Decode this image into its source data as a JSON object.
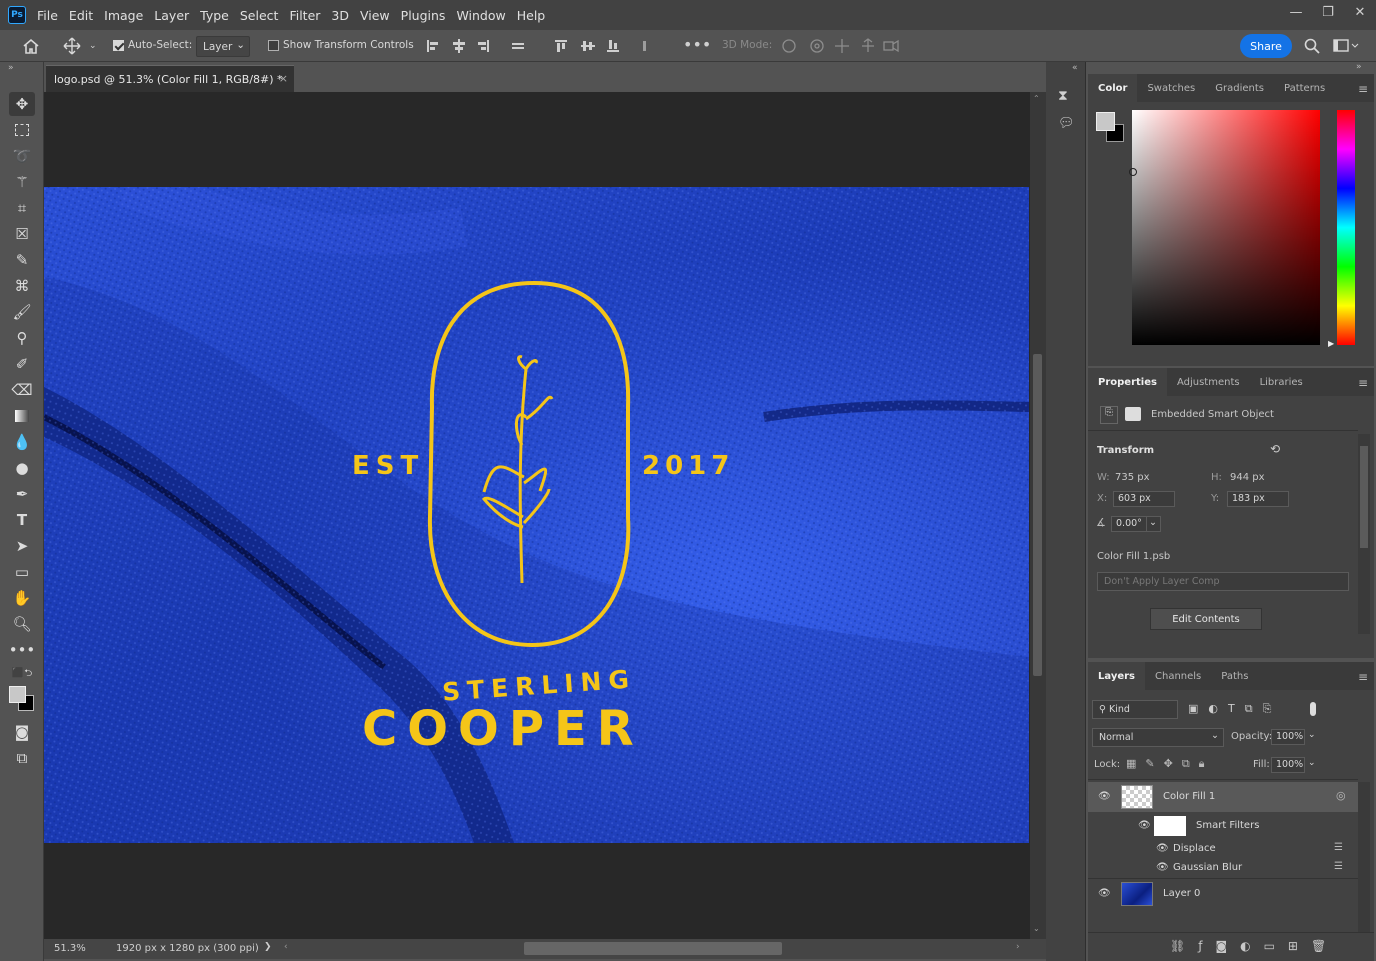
{
  "app": {
    "logo_text": "Ps"
  },
  "menu": [
    "File",
    "Edit",
    "Image",
    "Layer",
    "Type",
    "Select",
    "Filter",
    "3D",
    "View",
    "Plugins",
    "Window",
    "Help"
  ],
  "window_controls": {
    "minimize": "—",
    "maximize": "❐",
    "close": "✕"
  },
  "options_bar": {
    "auto_select_label": "Auto-Select:",
    "auto_select_checked": true,
    "auto_select_target": "Layer",
    "show_transform_label": "Show Transform Controls",
    "show_transform_checked": false,
    "mode_3d_label": "3D Mode:",
    "share_label": "Share"
  },
  "document": {
    "tab_title": "logo.psd @ 51.3% (Color Fill 1, RGB/8#) *",
    "close_glyph": "×",
    "zoom": "51.3%",
    "doc_info": "1920 px x 1280 px (300 ppi)",
    "status_arrow": "❯"
  },
  "artwork": {
    "left_text": "EST",
    "right_text": "2017",
    "top_word": "STERLING",
    "bottom_word": "COOPER",
    "logo_color": "#f5c518",
    "fabric_color": "#1d3fb8"
  },
  "color_panel": {
    "tabs": [
      "Color",
      "Swatches",
      "Gradients",
      "Patterns"
    ],
    "active_tab": "Color",
    "foreground": "#c8c8c8",
    "background": "#000000",
    "hue_color": "#ff0000"
  },
  "properties_panel": {
    "tabs": [
      "Properties",
      "Adjustments",
      "Libraries"
    ],
    "active_tab": "Properties",
    "object_type": "Embedded Smart Object",
    "section_title": "Transform",
    "w_label": "W:",
    "w_value": "735 px",
    "h_label": "H:",
    "h_value": "944 px",
    "x_label": "X:",
    "x_value": "603 px",
    "y_label": "Y:",
    "y_value": "183 px",
    "angle_value": "0.00°",
    "file_name": "Color Fill 1.psb",
    "layer_comp_placeholder": "Don't Apply Layer Comp",
    "edit_button": "Edit Contents"
  },
  "layers_panel": {
    "tabs": [
      "Layers",
      "Channels",
      "Paths"
    ],
    "active_tab": "Layers",
    "filter_kind": "Kind",
    "blend_mode": "Normal",
    "opacity_label": "Opacity:",
    "opacity_value": "100%",
    "lock_label": "Lock:",
    "fill_label": "Fill:",
    "fill_value": "100%",
    "layers": [
      {
        "name": "Color Fill 1",
        "selected": true
      },
      {
        "name": "Smart Filters"
      },
      {
        "name": "Displace"
      },
      {
        "name": "Gaussian Blur"
      },
      {
        "name": "Layer 0"
      }
    ]
  },
  "icons": {
    "home": "home-icon",
    "move": "move-icon",
    "search": "search-icon",
    "workspace": "workspace-icon"
  }
}
